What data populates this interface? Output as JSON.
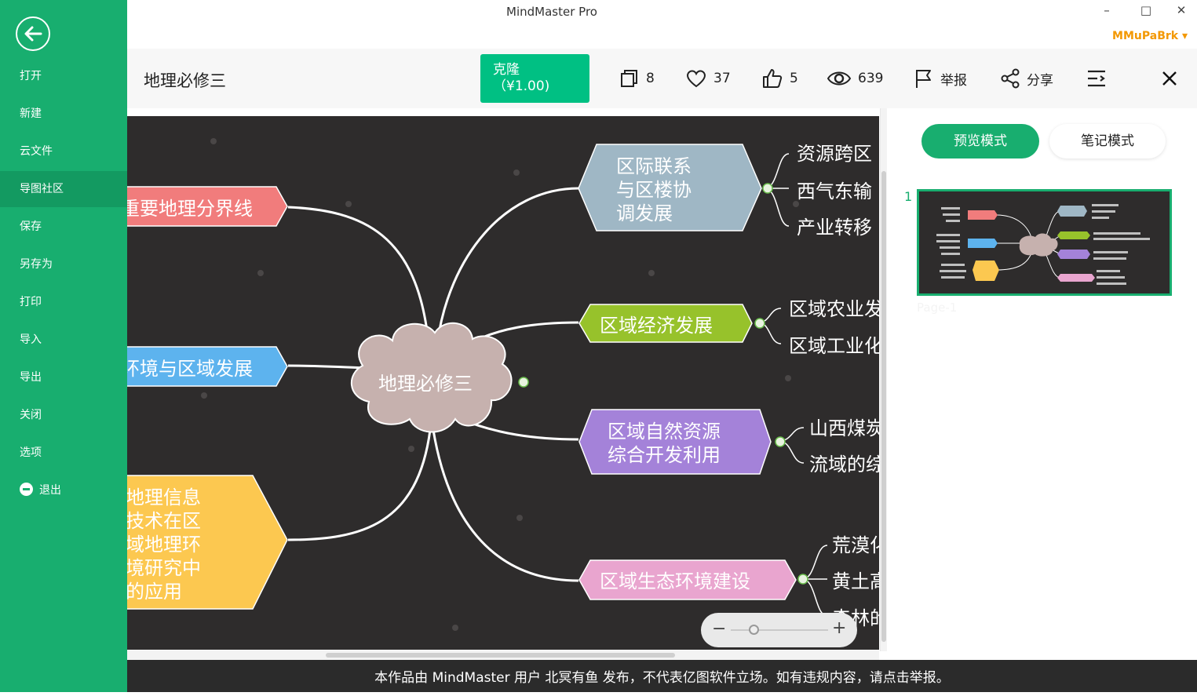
{
  "window": {
    "title": "MindMaster Pro",
    "minimize_glyph": "–",
    "maximize_glyph": "□",
    "close_glyph": "✕",
    "user": "MMuPaBrk ▾"
  },
  "sidebar": {
    "back_icon": "back-arrow-icon",
    "items": [
      {
        "label": "打开"
      },
      {
        "label": "新建"
      },
      {
        "label": "云文件"
      },
      {
        "label": "导图社区"
      },
      {
        "label": "保存"
      },
      {
        "label": "另存为"
      },
      {
        "label": "打印"
      },
      {
        "label": "导入"
      },
      {
        "label": "导出"
      },
      {
        "label": "关闭"
      },
      {
        "label": "选项"
      },
      {
        "label": "退出"
      }
    ]
  },
  "toolbar": {
    "doc_title": "地理必修三",
    "clone_label": "克隆",
    "clone_price": "（¥1.00)",
    "copies": "8",
    "favorites": "37",
    "likes": "5",
    "views": "639",
    "report": "举报",
    "share": "分享"
  },
  "mindmap": {
    "central": "地理必修三",
    "left_topics": [
      {
        "text": "重要地理分界线",
        "color": "#f17c7c"
      },
      {
        "text": "环境与区域发展",
        "color": "#5db3ee"
      },
      {
        "lines": [
          "地理信息",
          "技术在区",
          "域地理环",
          "境研究中",
          "的应用"
        ],
        "color": "#fcc850"
      }
    ],
    "right_topics": [
      {
        "lines": [
          "区际联系",
          "与区楼协",
          "调发展"
        ],
        "color": "#9fb7c5",
        "subs": [
          "资源跨区",
          "西气东输",
          "产业转移"
        ]
      },
      {
        "lines": [
          "区域经济发展"
        ],
        "color": "#97c22b",
        "subs": [
          "区域农业发",
          "区域工业化"
        ]
      },
      {
        "lines": [
          "区域自然资源",
          "综合开发利用"
        ],
        "color": "#a482d9",
        "subs": [
          "山西煤炭",
          "流域的综"
        ]
      },
      {
        "lines": [
          "区域生态环境建设"
        ],
        "color": "#e9a5cf",
        "subs": [
          "荒漠化",
          "黄土高",
          "森林的"
        ]
      }
    ],
    "line_color": "#ffffff",
    "background": "#2e2c2c"
  },
  "zoom": {
    "minus": "−",
    "plus": "+"
  },
  "right_panel": {
    "tab_preview": "预览模式",
    "tab_notes": "笔记模式",
    "page_number": "1",
    "page_label": "Page-1"
  },
  "footer": "本作品由 MindMaster 用户 北冥有鱼 发布，不代表亿图软件立场。如有违规内容，请点击举报。",
  "colors": {
    "accent": "#18ae6f",
    "clone": "#00c083",
    "user": "#f39800"
  }
}
